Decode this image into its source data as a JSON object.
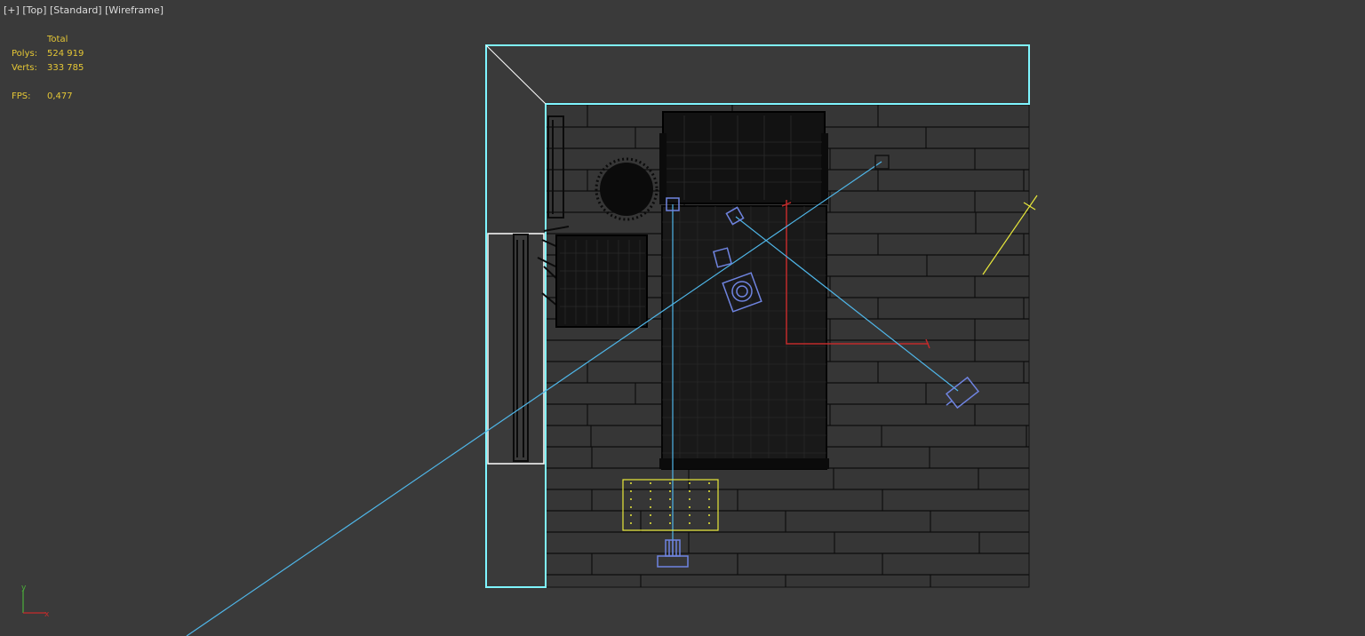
{
  "viewport": {
    "label_plus": "[+]",
    "label_view": "[Top]",
    "label_shading": "[Standard]",
    "label_mode": "[Wireframe]"
  },
  "stats": {
    "header": "Total",
    "polys_label": "Polys:",
    "polys_value": "524 919",
    "verts_label": "Verts:",
    "verts_value": "333 785",
    "fps_label": "FPS:",
    "fps_value": "0,477"
  },
  "axis": {
    "y_label": "y",
    "x_label": "x"
  },
  "colors": {
    "background": "#3a3a3a",
    "floor": "#383838",
    "wireframe": "#0d0d0d",
    "selected_wall": "#7ff5ff",
    "camera": "#6f84e0",
    "camera_line": "#4fb6e8",
    "light": "#e8e83a",
    "stats_text": "#e5c735",
    "label_text": "#dcdcdc"
  }
}
